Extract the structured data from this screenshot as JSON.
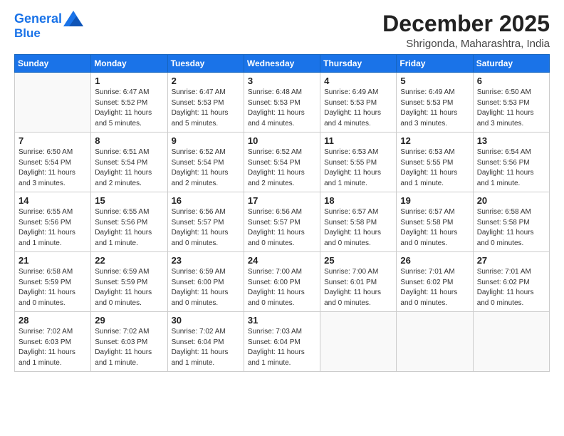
{
  "logo": {
    "line1": "General",
    "line2": "Blue"
  },
  "title": "December 2025",
  "location": "Shrigonda, Maharashtra, India",
  "weekdays": [
    "Sunday",
    "Monday",
    "Tuesday",
    "Wednesday",
    "Thursday",
    "Friday",
    "Saturday"
  ],
  "weeks": [
    [
      {
        "day": "",
        "info": ""
      },
      {
        "day": "1",
        "info": "Sunrise: 6:47 AM\nSunset: 5:52 PM\nDaylight: 11 hours\nand 5 minutes."
      },
      {
        "day": "2",
        "info": "Sunrise: 6:47 AM\nSunset: 5:53 PM\nDaylight: 11 hours\nand 5 minutes."
      },
      {
        "day": "3",
        "info": "Sunrise: 6:48 AM\nSunset: 5:53 PM\nDaylight: 11 hours\nand 4 minutes."
      },
      {
        "day": "4",
        "info": "Sunrise: 6:49 AM\nSunset: 5:53 PM\nDaylight: 11 hours\nand 4 minutes."
      },
      {
        "day": "5",
        "info": "Sunrise: 6:49 AM\nSunset: 5:53 PM\nDaylight: 11 hours\nand 3 minutes."
      },
      {
        "day": "6",
        "info": "Sunrise: 6:50 AM\nSunset: 5:53 PM\nDaylight: 11 hours\nand 3 minutes."
      }
    ],
    [
      {
        "day": "7",
        "info": "Sunrise: 6:50 AM\nSunset: 5:54 PM\nDaylight: 11 hours\nand 3 minutes."
      },
      {
        "day": "8",
        "info": "Sunrise: 6:51 AM\nSunset: 5:54 PM\nDaylight: 11 hours\nand 2 minutes."
      },
      {
        "day": "9",
        "info": "Sunrise: 6:52 AM\nSunset: 5:54 PM\nDaylight: 11 hours\nand 2 minutes."
      },
      {
        "day": "10",
        "info": "Sunrise: 6:52 AM\nSunset: 5:54 PM\nDaylight: 11 hours\nand 2 minutes."
      },
      {
        "day": "11",
        "info": "Sunrise: 6:53 AM\nSunset: 5:55 PM\nDaylight: 11 hours\nand 1 minute."
      },
      {
        "day": "12",
        "info": "Sunrise: 6:53 AM\nSunset: 5:55 PM\nDaylight: 11 hours\nand 1 minute."
      },
      {
        "day": "13",
        "info": "Sunrise: 6:54 AM\nSunset: 5:56 PM\nDaylight: 11 hours\nand 1 minute."
      }
    ],
    [
      {
        "day": "14",
        "info": "Sunrise: 6:55 AM\nSunset: 5:56 PM\nDaylight: 11 hours\nand 1 minute."
      },
      {
        "day": "15",
        "info": "Sunrise: 6:55 AM\nSunset: 5:56 PM\nDaylight: 11 hours\nand 1 minute."
      },
      {
        "day": "16",
        "info": "Sunrise: 6:56 AM\nSunset: 5:57 PM\nDaylight: 11 hours\nand 0 minutes."
      },
      {
        "day": "17",
        "info": "Sunrise: 6:56 AM\nSunset: 5:57 PM\nDaylight: 11 hours\nand 0 minutes."
      },
      {
        "day": "18",
        "info": "Sunrise: 6:57 AM\nSunset: 5:58 PM\nDaylight: 11 hours\nand 0 minutes."
      },
      {
        "day": "19",
        "info": "Sunrise: 6:57 AM\nSunset: 5:58 PM\nDaylight: 11 hours\nand 0 minutes."
      },
      {
        "day": "20",
        "info": "Sunrise: 6:58 AM\nSunset: 5:58 PM\nDaylight: 11 hours\nand 0 minutes."
      }
    ],
    [
      {
        "day": "21",
        "info": "Sunrise: 6:58 AM\nSunset: 5:59 PM\nDaylight: 11 hours\nand 0 minutes."
      },
      {
        "day": "22",
        "info": "Sunrise: 6:59 AM\nSunset: 5:59 PM\nDaylight: 11 hours\nand 0 minutes."
      },
      {
        "day": "23",
        "info": "Sunrise: 6:59 AM\nSunset: 6:00 PM\nDaylight: 11 hours\nand 0 minutes."
      },
      {
        "day": "24",
        "info": "Sunrise: 7:00 AM\nSunset: 6:00 PM\nDaylight: 11 hours\nand 0 minutes."
      },
      {
        "day": "25",
        "info": "Sunrise: 7:00 AM\nSunset: 6:01 PM\nDaylight: 11 hours\nand 0 minutes."
      },
      {
        "day": "26",
        "info": "Sunrise: 7:01 AM\nSunset: 6:02 PM\nDaylight: 11 hours\nand 0 minutes."
      },
      {
        "day": "27",
        "info": "Sunrise: 7:01 AM\nSunset: 6:02 PM\nDaylight: 11 hours\nand 0 minutes."
      }
    ],
    [
      {
        "day": "28",
        "info": "Sunrise: 7:02 AM\nSunset: 6:03 PM\nDaylight: 11 hours\nand 1 minute."
      },
      {
        "day": "29",
        "info": "Sunrise: 7:02 AM\nSunset: 6:03 PM\nDaylight: 11 hours\nand 1 minute."
      },
      {
        "day": "30",
        "info": "Sunrise: 7:02 AM\nSunset: 6:04 PM\nDaylight: 11 hours\nand 1 minute."
      },
      {
        "day": "31",
        "info": "Sunrise: 7:03 AM\nSunset: 6:04 PM\nDaylight: 11 hours\nand 1 minute."
      },
      {
        "day": "",
        "info": ""
      },
      {
        "day": "",
        "info": ""
      },
      {
        "day": "",
        "info": ""
      }
    ]
  ]
}
